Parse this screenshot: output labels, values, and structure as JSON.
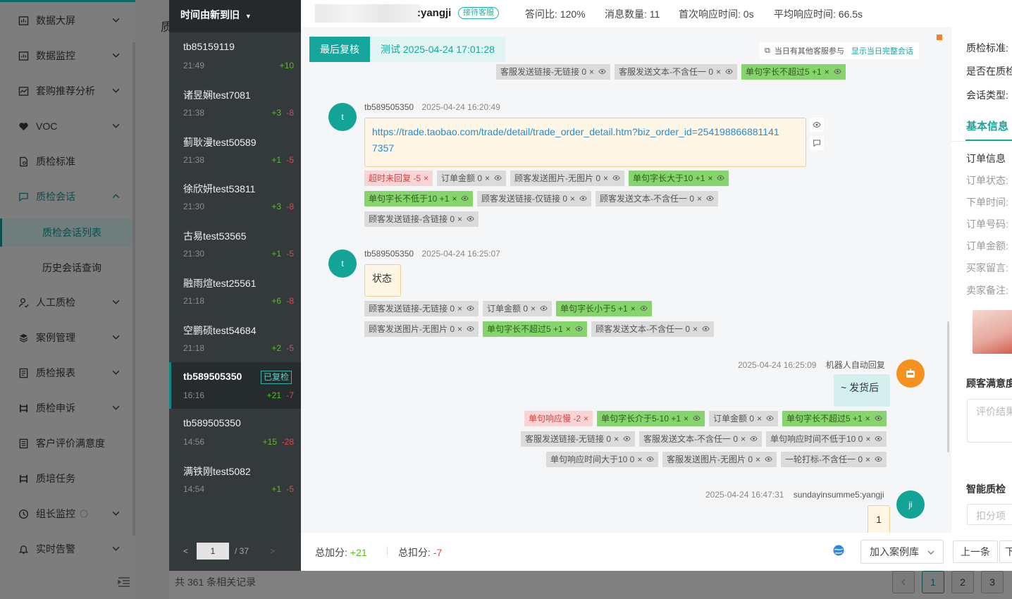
{
  "nav": {
    "items": [
      {
        "label": "数据大屏",
        "icon": "dashboard-icon"
      },
      {
        "label": "数据监控",
        "icon": "monitor-icon"
      },
      {
        "label": "套购推荐分析",
        "icon": "analysis-icon"
      },
      {
        "label": "VOC",
        "icon": "heart-icon"
      },
      {
        "label": "质检标准",
        "icon": "document-icon"
      },
      {
        "label": "质检会话",
        "icon": "chat-icon"
      },
      {
        "label": "人工质检",
        "icon": "person-icon"
      },
      {
        "label": "案例管理",
        "icon": "layers-icon"
      },
      {
        "label": "质检报表",
        "icon": "report-icon"
      },
      {
        "label": "质检申诉",
        "icon": "appeal-icon"
      },
      {
        "label": "客户评价满意度",
        "icon": "rating-icon"
      },
      {
        "label": "质培任务",
        "icon": "task-icon"
      },
      {
        "label": "组长监控",
        "icon": "clock-icon"
      },
      {
        "label": "实时告警",
        "icon": "bell-icon"
      }
    ],
    "sub_items": [
      "质检会话列表",
      "历史会话查询"
    ]
  },
  "background": {
    "title_partial": "质",
    "record_count": "共 361 条相关记录",
    "pages": [
      "1",
      "2",
      "3"
    ]
  },
  "session_list": {
    "sort_label": "时间由新到旧",
    "sessions": [
      {
        "name": "tb85159119",
        "time": "21:49",
        "plus": "+10",
        "minus": ""
      },
      {
        "name": "诸昱娴test7081",
        "time": "21:38",
        "plus": "+3",
        "minus": "-8"
      },
      {
        "name": "蓟耿漫test50589",
        "time": "21:38",
        "plus": "+1",
        "minus": "-5"
      },
      {
        "name": "徐欣妍test53811",
        "time": "21:30",
        "plus": "+3",
        "minus": "-8"
      },
      {
        "name": "古易test53565",
        "time": "21:30",
        "plus": "+1",
        "minus": "-5"
      },
      {
        "name": "融雨煊test25561",
        "time": "21:18",
        "plus": "+6",
        "minus": "-8"
      },
      {
        "name": "空鹏硕test54684",
        "time": "21:18",
        "plus": "+2",
        "minus": "-5"
      },
      {
        "name": "tb589505350",
        "time": "16:16",
        "plus": "+21",
        "minus": "-7",
        "badge": "已复检"
      },
      {
        "name": "tb589505350",
        "time": "14:56",
        "plus": "+15",
        "minus": "-28"
      },
      {
        "name": "满铁刚test5082",
        "time": "14:54",
        "plus": "+1",
        "minus": "-5"
      }
    ],
    "pager": {
      "current": "1",
      "total": "/ 37"
    }
  },
  "chat_header": {
    "agent_name": ":yangji",
    "agent_badge": "接待客服",
    "stats": [
      "答问比: 120%",
      "消息数量: 11",
      "首次响应时间: 0s",
      "平均响应时间: 66.5s"
    ]
  },
  "review_bar": {
    "active_tab": "最后复核",
    "tab": "测试   2025-04-24 17:01:28",
    "other_cs_note": "当日有其他客服参与",
    "show_full_link": "显示当日完整会话"
  },
  "top_tags": [
    {
      "text": "客服发送链接-无链接 0",
      "type": "gray"
    },
    {
      "text": "客服发送文本-不含任一 0",
      "type": "gray"
    },
    {
      "text": "单句字长不超过5 +1",
      "type": "green"
    }
  ],
  "messages": [
    {
      "sender": "tb589505350",
      "time": "2025-04-24 16:20:49",
      "avatar": "t",
      "text_line1": "https://trade.taobao.com/trade/detail/trade_order_detail.htm?biz_order_id=254198866881141",
      "text_line2": "7357",
      "tags": [
        {
          "text": "超时未回复 -5",
          "type": "pink"
        },
        {
          "text": "订单金额 0",
          "type": "gray"
        },
        {
          "text": "顾客发送图片-无图片 0",
          "type": "gray"
        },
        {
          "text": "单句字长大于10 +1",
          "type": "green"
        },
        {
          "text": "单句字长不低于10 +1",
          "type": "green"
        },
        {
          "text": "顾客发送链接-仅链接 0",
          "type": "gray"
        },
        {
          "text": "顾客发送文本-不含任一 0",
          "type": "gray"
        },
        {
          "text": "顾客发送链接-含链接 0",
          "type": "gray"
        }
      ]
    },
    {
      "sender": "tb589505350",
      "time": "2025-04-24 16:25:07",
      "avatar": "t",
      "text": "状态",
      "tags": [
        {
          "text": "顾客发送链接-无链接 0",
          "type": "gray"
        },
        {
          "text": "订单金额 0",
          "type": "gray"
        },
        {
          "text": "单句字长小于5 +1",
          "type": "green"
        },
        {
          "text": "顾客发送图片-无图片 0",
          "type": "gray"
        },
        {
          "text": "单句字长不超过5 +1",
          "type": "green"
        },
        {
          "text": "顾客发送文本-不含任一 0",
          "type": "gray"
        }
      ]
    },
    {
      "sender": "机器人自动回复",
      "time": "2025-04-24 16:25:09",
      "text": "~ 发货后",
      "tags": [
        {
          "text": "单句响应慢 -2",
          "type": "pink"
        },
        {
          "text": "单句字长介于5-10 +1",
          "type": "green"
        },
        {
          "text": "订单金额 0",
          "type": "gray"
        },
        {
          "text": "单句字长不超过5 +1",
          "type": "green"
        },
        {
          "text": "客服发送链接-无链接 0",
          "type": "gray"
        },
        {
          "text": "客服发送文本-不含任一 0",
          "type": "gray"
        },
        {
          "text": "单句响应时间不低于10 0",
          "type": "gray"
        },
        {
          "text": "单句响应时间大于10 0",
          "type": "gray"
        },
        {
          "text": "客服发送图片-无图片 0",
          "type": "gray"
        },
        {
          "text": "一轮打标-不含任一 0",
          "type": "gray"
        }
      ]
    },
    {
      "sender": "sundayinsumme5:yangji",
      "time": "2025-04-24 16:47:31",
      "avatar": "ji",
      "text": "1"
    }
  ],
  "chat_footer": {
    "plus_label": "总加分:",
    "plus_value": "+21",
    "minus_label": "总扣分:",
    "minus_value": "-7",
    "case_button": "加入案例库",
    "prev_button": "上一条",
    "next_button": "下"
  },
  "info_panel": {
    "top_lines": [
      "质检标准:",
      "是否在质检",
      "会话类型:"
    ],
    "tab": "基本信息",
    "order_title": "订单信息",
    "order_fields": [
      "订单状态:",
      "下单时间:",
      "订单号码:",
      "订单金额:",
      "买家留言:",
      "卖家备注:"
    ],
    "satisfaction_title": "顾客满意度",
    "satisfaction_placeholder": "评价结果",
    "smart_qc_title": "智能质检",
    "deduct_placeholder": "扣分项"
  },
  "colors": {
    "accent": "#16a79c",
    "plus": "#52c41a",
    "minus": "#e84545"
  }
}
